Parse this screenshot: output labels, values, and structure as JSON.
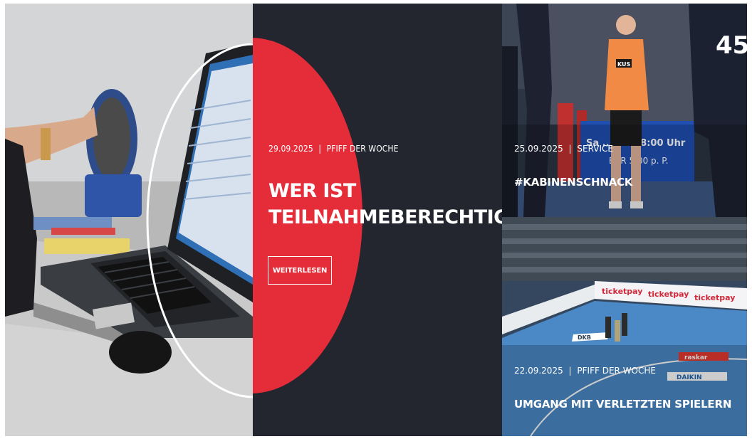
{
  "hero": {
    "date": "29.09.2025",
    "separator": "|",
    "category": "PFIFF DER WOCHE",
    "title_line1": "WER IST",
    "title_line2": "TEILNAHMEBERECHTIGT?",
    "button_label": "WEITERLESEN"
  },
  "cards": [
    {
      "date": "25.09.2025",
      "separator": "|",
      "category": "SERVICE",
      "title": "#KABINENSCHNACK",
      "image_text": {
        "jersey_number": "45",
        "referee_badge": "KUS",
        "banner_text": "Sa ... G - 18:00 Uhr",
        "banner_price": "EUR 5,00 p. P."
      }
    },
    {
      "date": "22.09.2025",
      "separator": "|",
      "category": "PFIFF DER WOCHE",
      "title": "UMGANG MIT VERLETZTEN SPIELERN",
      "image_text": {
        "ad_1": "ticketpay",
        "ad_2": "ticketpay",
        "ad_3": "ticketpay",
        "floor_1": "DKB",
        "floor_2": "raskar",
        "floor_3": "DAIKIN"
      }
    }
  ],
  "colors": {
    "accent_red": "#e52d3a",
    "dark_bg": "#23262f",
    "text": "#ffffff"
  }
}
